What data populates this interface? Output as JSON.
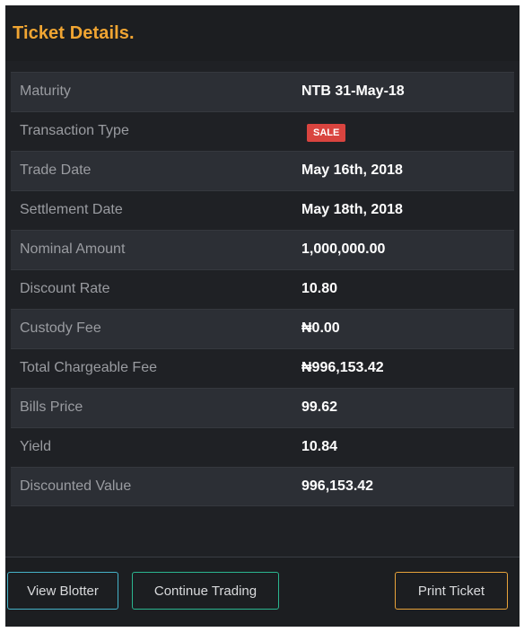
{
  "panel": {
    "title": "Ticket Details."
  },
  "colors": {
    "title_accent": "#f0a532",
    "badge_sale": "#d9443f",
    "btn_blotter_border": "#45b3c9",
    "btn_continue_border": "#2bb58f",
    "btn_print_border": "#e8a33a"
  },
  "details": [
    {
      "label": "Maturity",
      "value": "NTB 31-May-18"
    },
    {
      "label": "Transaction Type",
      "badge": "SALE"
    },
    {
      "label": "Trade Date",
      "value": "May 16th, 2018"
    },
    {
      "label": "Settlement Date",
      "value": "May 18th, 2018"
    },
    {
      "label": "Nominal Amount",
      "value": "1,000,000.00"
    },
    {
      "label": "Discount Rate",
      "value": "10.80"
    },
    {
      "label": "Custody Fee",
      "value": "₦0.00"
    },
    {
      "label": "Total Chargeable Fee",
      "value": "₦996,153.42"
    },
    {
      "label": "Bills Price",
      "value": "99.62"
    },
    {
      "label": "Yield",
      "value": "10.84"
    },
    {
      "label": "Discounted Value",
      "value": "996,153.42"
    }
  ],
  "footer": {
    "view_blotter_label": "View Blotter",
    "continue_trading_label": "Continue Trading",
    "print_ticket_label": "Print Ticket"
  }
}
